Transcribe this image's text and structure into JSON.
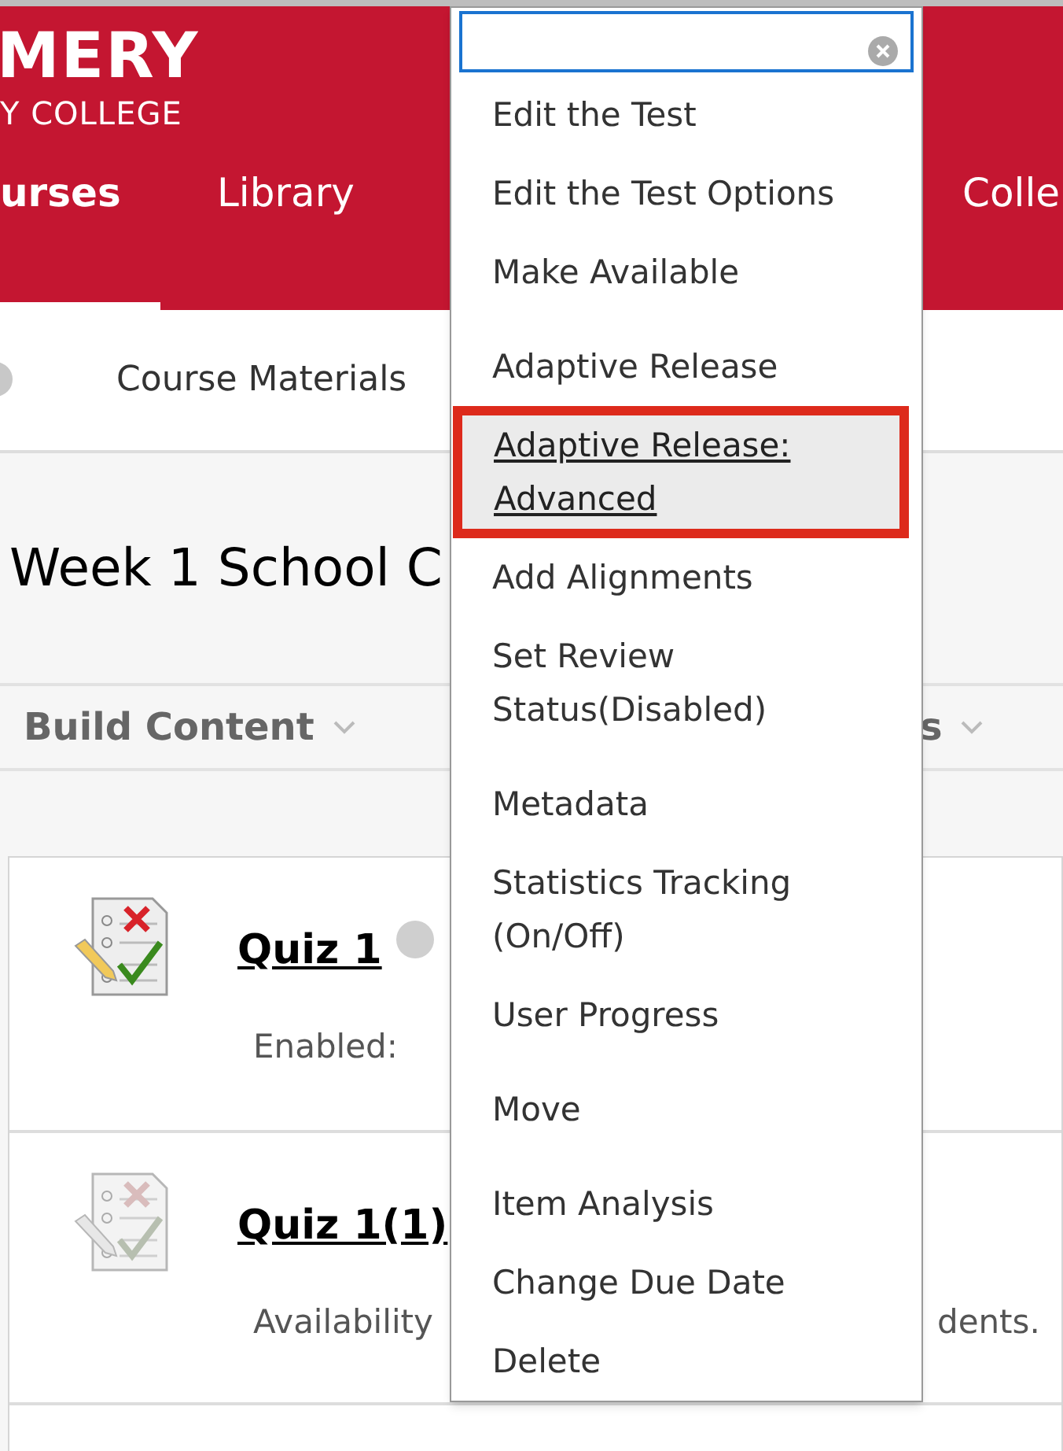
{
  "header": {
    "logo_lines": [
      "MERY",
      "Y COLLEGE"
    ],
    "nav": [
      {
        "label": "urses",
        "selected": true
      },
      {
        "label": "Library",
        "selected": false
      },
      {
        "label": "Colle",
        "selected": false
      }
    ]
  },
  "course_menu": {
    "label": "Course Materials"
  },
  "page_title": "Week 1 School C",
  "toolbar": [
    {
      "label": "Build Content"
    },
    {
      "label": "s"
    }
  ],
  "items": [
    {
      "title": "Quiz 1",
      "dimmed": false,
      "meta": "Enabled:"
    },
    {
      "title": "Quiz 1(1)",
      "dimmed": true,
      "meta": "Availability",
      "meta_end": "dents."
    }
  ],
  "context_menu": {
    "groups": [
      [
        {
          "label": "Edit the Test",
          "selected": false
        },
        {
          "label": "Edit the Test Options",
          "selected": false
        },
        {
          "label": "Make Available",
          "selected": false
        }
      ],
      [
        {
          "label": "Adaptive Release",
          "selected": false
        },
        {
          "label": "Adaptive Release: Advanced",
          "selected": true
        },
        {
          "label": "Add Alignments",
          "selected": false
        },
        {
          "label": "Set Review Status(Disabled)",
          "selected": false
        }
      ],
      [
        {
          "label": "Metadata",
          "selected": false
        },
        {
          "label": "Statistics Tracking (On/Off)",
          "selected": false
        },
        {
          "label": "User Progress",
          "selected": false
        }
      ],
      [
        {
          "label": "Move",
          "selected": false
        }
      ],
      [
        {
          "label": "Item Analysis",
          "selected": false
        },
        {
          "label": "Change Due Date",
          "selected": false
        },
        {
          "label": "Delete",
          "selected": false
        }
      ]
    ]
  }
}
